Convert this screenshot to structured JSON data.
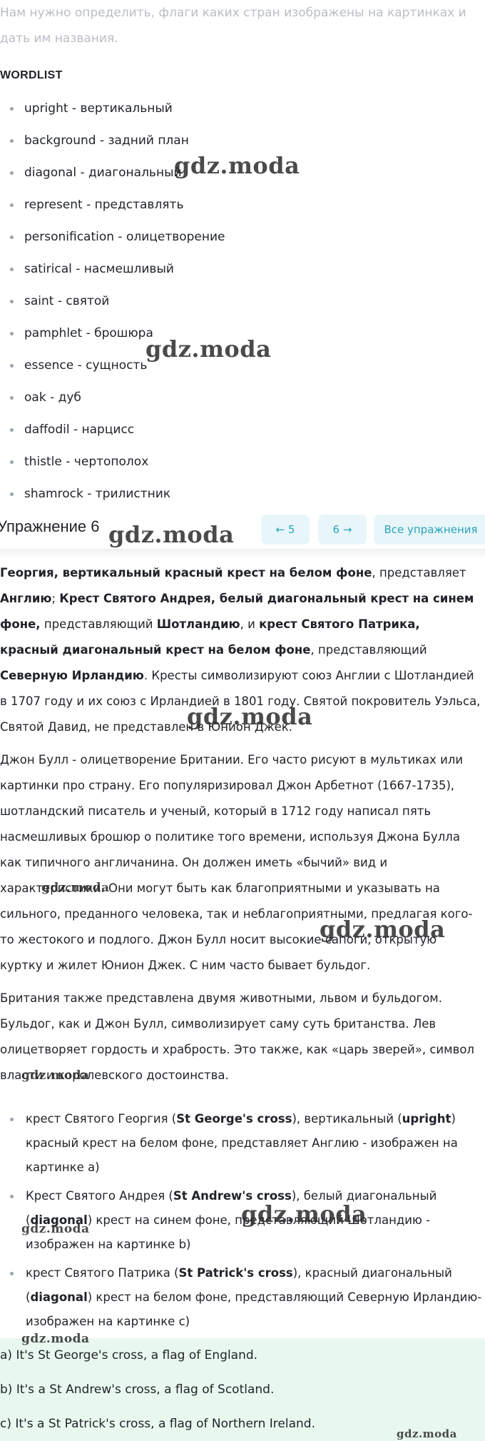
{
  "intro": "Нам нужно определить, флаги каких стран изображены на картинках и дать им названия.",
  "wordlist": {
    "title": "WORDLIST",
    "items": [
      "upright - вертикальный",
      "background - задний план",
      "diagonal - диагональный",
      "represent - представлять",
      "personification - олицетворение",
      "satirical - насмешливый",
      "saint - святой",
      "pamphlet - брошюра",
      "essence - сущность",
      "oak - дуб",
      "daffodil - нарцисс",
      "thistle - чертополох",
      "shamrock - трилистник"
    ]
  },
  "exercise": {
    "title": "Упражнение 6",
    "prev_label": "← 5",
    "next_label": "6 →",
    "all_label": "Все упражнения"
  },
  "p1": {
    "s1": "Георгия, вертикальный красный крест на белом фоне",
    "s2": ", представляет ",
    "s3": "Англию",
    "s4": "; ",
    "s5": "Крест Святого Андрея, белый диагональный крест на синем фоне,",
    "s6": " представляющий ",
    "s7": "Шотландию",
    "s8": ", и ",
    "s9": "крест Святого Патрика, красный диагональный крест на белом фоне",
    "s10": ", представляющий ",
    "s11": "Северную Ирландию",
    "s12": ". Кресты символизируют союз Англии с Шотландией в 1707 году и их союз с Ирландией в 1801 году. Святой покровитель Уэльса, Святой Давид, не представлен в Юнион Джек."
  },
  "p2": "Джон Булл - олицетворение Британии. Его часто рисуют в мультиках или картинки про страну. Его популяризировал Джон Арбетнот (1667-1735), шотландский писатель и ученый, который в 1712 году написал пять насмешливых брошюр о политике того времени, используя Джона Булла как типичного англичанина. Он должен иметь «бычий» вид и характеристики. Они могут быть как благоприятными и указывать на сильного, преданного человека, так и неблагоприятными, предлагая кого-то жестокого и подлого. Джон Булл носит высокие сапоги, открытую куртку и жилет Юнион Джек. С ним часто бывает бульдог.",
  "p3": "Британия также представлена двумя животными, львом и бульдогом. Бульдог, как и Джон Булл, символизирует саму суть британства. Лев олицетворяет гордость и храбрость. Это также, как «царь зверей», символ власти и королевского достоинства.",
  "answers": [
    {
      "a": "крест Святого Георгия (",
      "b": "St George's cross",
      "c": "), вертикальный (",
      "d": "upright",
      "e": ") красный крест на белом фоне, представляет Англию - изображен на картинке а)"
    },
    {
      "a": "Крест Святого Андрея (",
      "b": "St Andrew's cross",
      "c": "), белый диагональный (",
      "d": "diagonal",
      "e": ") крест на синем фоне, представляющий Шотландию - изображен на картинке b)"
    },
    {
      "a": "крест Святого Патрика (",
      "b": "St Patrick's cross",
      "c": "), красный диагональный (",
      "d": "diagonal",
      "e": ") крест на белом фоне, представляющий Северную Ирландию- изображен на картинке с)"
    }
  ],
  "final": [
    "a) It's St George's cross, a flag of England.",
    "b) It's a St Andrew's cross, a flag of Scotland.",
    "c) It's a St Patrick's cross, a flag of Northern Ireland."
  ],
  "watermark": "gdz.moda",
  "colors": {
    "accent": "#2aa3bf",
    "nav_bg": "#e8f6f9",
    "answer_bg": "#e9f8ef",
    "muted": "#b9bec4"
  }
}
